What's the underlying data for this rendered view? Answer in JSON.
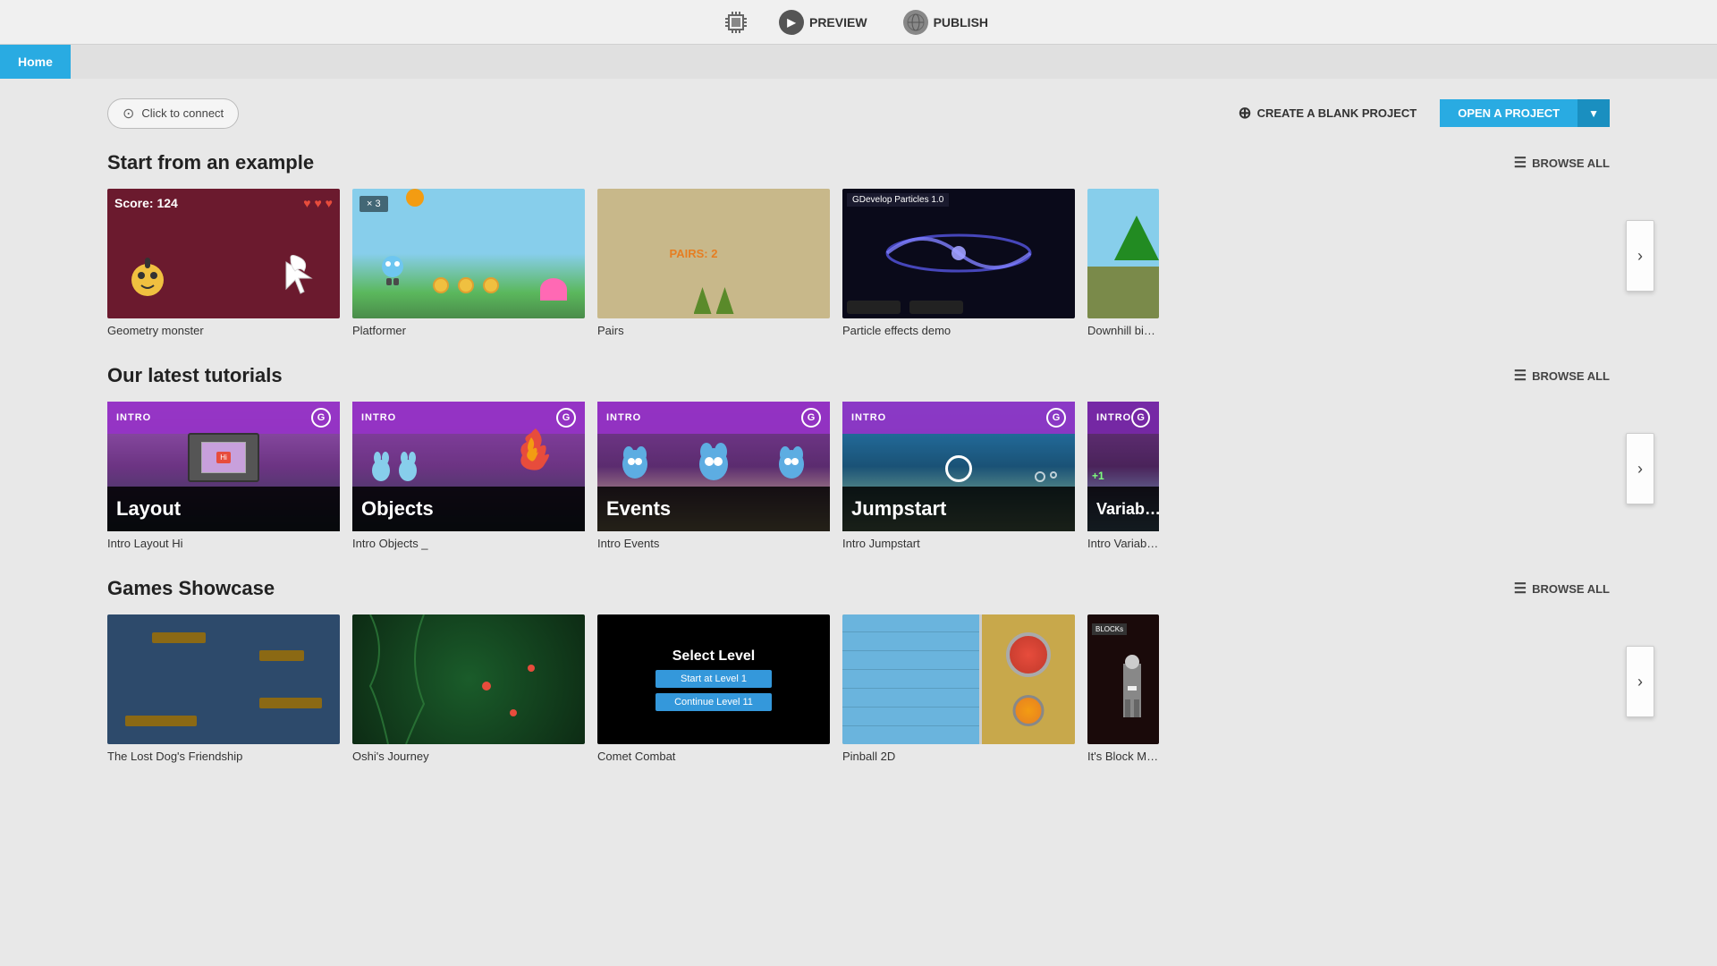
{
  "topbar": {
    "preview_label": "PREVIEW",
    "publish_label": "PUBLISH"
  },
  "navbar": {
    "home_label": "Home"
  },
  "actions": {
    "click_to_connect": "Click to connect",
    "create_blank": "CREATE A BLANK PROJECT",
    "open_project": "OPEN A PROJECT"
  },
  "sections": {
    "examples": {
      "title": "Start from an example",
      "browse_all": "BROWSE ALL",
      "cards": [
        {
          "label": "Geometry monster",
          "theme": "geometry"
        },
        {
          "label": "Platformer",
          "theme": "platformer"
        },
        {
          "label": "Pairs",
          "theme": "pairs"
        },
        {
          "label": "Particle effects demo",
          "theme": "particles"
        },
        {
          "label": "Downhill bike",
          "theme": "downhill"
        }
      ]
    },
    "tutorials": {
      "title": "Our latest tutorials",
      "browse_all": "BROWSE ALL",
      "cards": [
        {
          "intro": "Intro",
          "title": "Layout",
          "theme": "tut-layout"
        },
        {
          "intro": "Intro",
          "title": "Objects",
          "theme": "tut-objects"
        },
        {
          "intro": "Intro",
          "title": "Events",
          "theme": "tut-events"
        },
        {
          "intro": "Intro",
          "title": "Jumpstart",
          "theme": "tut-jumpstart"
        },
        {
          "intro": "Intro",
          "title": "Variab",
          "theme": "tut-variables"
        }
      ]
    },
    "showcase": {
      "title": "Games Showcase",
      "browse_all": "BROWSE ALL",
      "cards": [
        {
          "label": "The Lost Dog's Friendship",
          "theme": "lost-dog"
        },
        {
          "label": "Oshi's Journey",
          "theme": "oshi"
        },
        {
          "label": "Comet Combat",
          "theme": "comet"
        },
        {
          "label": "Pinball 2D",
          "theme": "pinball"
        },
        {
          "label": "It's Block Ma…",
          "theme": "blocks"
        }
      ]
    }
  },
  "comet": {
    "title": "Select Level",
    "btn1": "Start at Level 1",
    "btn2": "Continue Level 11"
  }
}
